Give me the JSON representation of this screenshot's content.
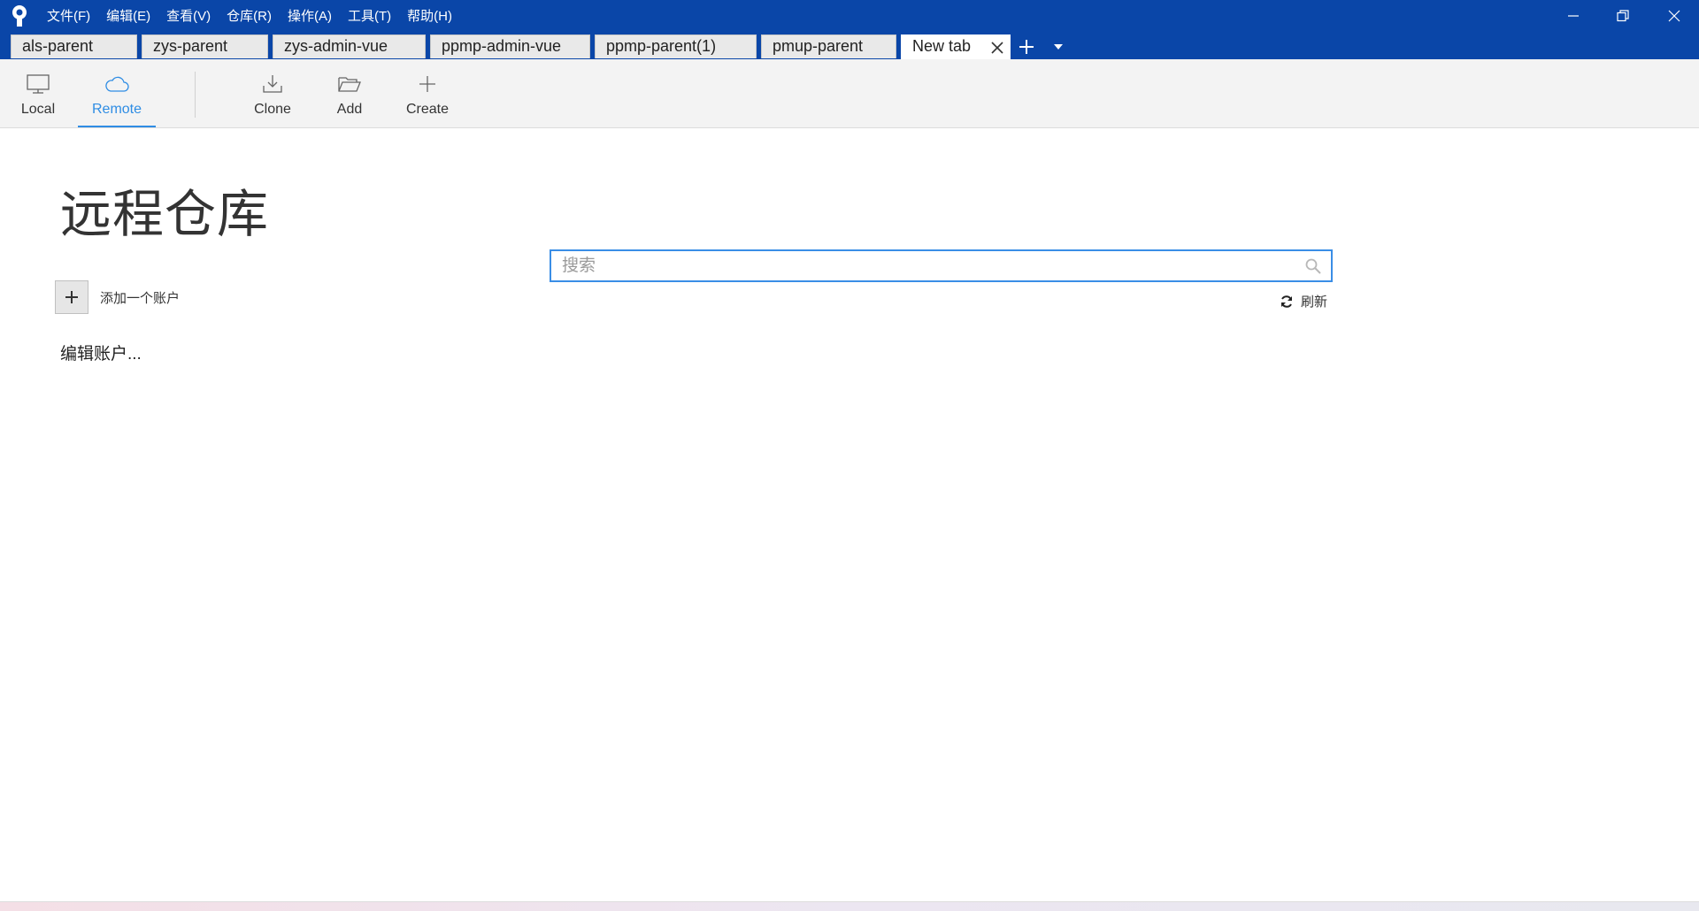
{
  "menu": [
    "文件(F)",
    "编辑(E)",
    "查看(V)",
    "仓库(R)",
    "操作(A)",
    "工具(T)",
    "帮助(H)"
  ],
  "tabs": [
    "als-parent",
    "zys-parent",
    "zys-admin-vue",
    "ppmp-admin-vue",
    "ppmp-parent(1)",
    "pmup-parent",
    "New tab"
  ],
  "toolbar": {
    "local": "Local",
    "remote": "Remote",
    "clone": "Clone",
    "add": "Add",
    "create": "Create"
  },
  "main": {
    "title": "远程仓库",
    "add_account": "添加一个账户",
    "edit_accounts": "编辑账户...",
    "search_placeholder": "搜索",
    "refresh": "刷新"
  },
  "colors": {
    "titlebar": "#0a46a8",
    "accent": "#2f8de4"
  }
}
